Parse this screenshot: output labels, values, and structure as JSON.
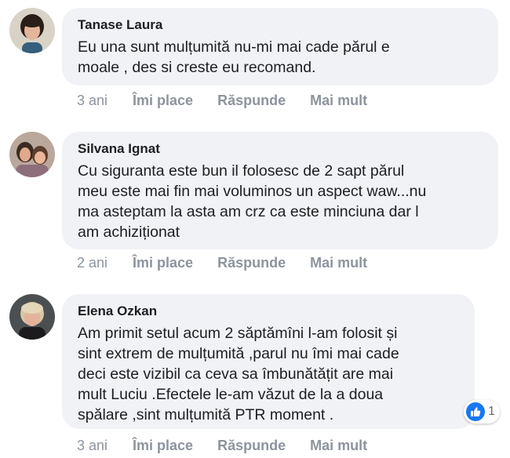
{
  "comments": [
    {
      "author": "Tanase Laura",
      "lines": [
        "Eu una sunt mulțumită nu-mi mai cade părul e",
        "moale , des si creste eu recomand."
      ],
      "time": "3 ani",
      "like_label": "Îmi place",
      "reply_label": "Răspunde",
      "more_label": "Mai mult"
    },
    {
      "author": "Silvana Ignat",
      "lines": [
        "Cu siguranta este bun il folosesc de 2 sapt părul",
        "meu este mai fin mai voluminos un aspect waw...nu",
        "ma asteptam la asta am crz ca este minciuna dar l",
        "am achiziționat"
      ],
      "time": "2 ani",
      "like_label": "Îmi place",
      "reply_label": "Răspunde",
      "more_label": "Mai mult"
    },
    {
      "author": "Elena Ozkan",
      "lines": [
        "Am primit setul acum 2 săptămîni l-am folosit și",
        "sint extrem de mulțumită ,parul nu îmi mai cade",
        "deci este vizibil ca ceva sa îmbunătățit are mai",
        "mult Luciu .Efectele le-am văzut de la a doua",
        "spălare ,sint mulțumită PTR moment ."
      ],
      "time": "3 ani",
      "like_label": "Îmi place",
      "reply_label": "Răspunde",
      "more_label": "Mai mult",
      "reaction_count": "1"
    }
  ],
  "colors": {
    "bubble": "#f0f2f5",
    "meta": "#8d949e",
    "like_blue": "#1877f2"
  },
  "icons": {
    "reaction": "thumbs-up-icon"
  }
}
